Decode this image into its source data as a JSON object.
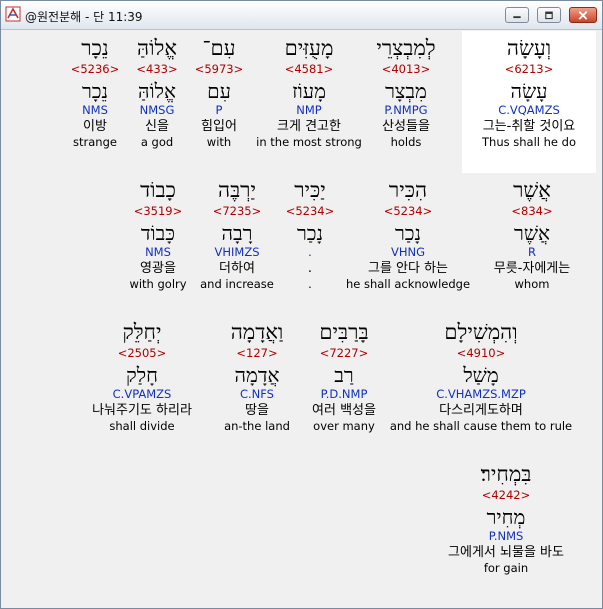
{
  "window": {
    "title": "@원전분해 - 단 11:39"
  },
  "rows": [
    [
      {
        "heb": "וְעָשָׂה",
        "strong": "<6213>",
        "lemma": "עָשָׂה",
        "parse": "C.VQAMZS",
        "kor": "그는-취할 것이요",
        "eng": "Thus shall he do"
      },
      {
        "heb": "לְמִבְצְרֵי",
        "strong": "<4013>",
        "lemma": "מִבְצָר",
        "parse": "P.NMPG",
        "kor": "산성들을",
        "eng": "holds"
      },
      {
        "heb": "מָעֻזִּים",
        "strong": "<4581>",
        "lemma": "מָעוֹז",
        "parse": "NMP",
        "kor": "크게 견고한",
        "eng": "in the most strong"
      },
      {
        "heb": "עִם־",
        "strong": "<5973>",
        "lemma": "עִם",
        "parse": "P",
        "kor": "힘입어",
        "eng": "with"
      },
      {
        "heb": "אֱלוֹהַּ",
        "strong": "<433>",
        "lemma": "אֱלוֹהַּ",
        "parse": "NMSG",
        "kor": "신을",
        "eng": "a god"
      },
      {
        "heb": "נֵכָר",
        "strong": "<5236>",
        "lemma": "נֵכָר",
        "parse": "NMS",
        "kor": "이방",
        "eng": "strange"
      }
    ],
    [
      {
        "heb": "אֲשֶׁר",
        "strong": "<834>",
        "lemma": "אֲשֶׁר",
        "parse": "R",
        "kor": "무릇-자에게는",
        "eng": "whom"
      },
      {
        "heb": "הִכִּיר",
        "strong": "<5234>",
        "lemma": "נָכַר",
        "parse": "VHNG",
        "kor": "그를 안다 하는",
        "eng": "he shall acknowledge"
      },
      {
        "heb": "יַכִּיר",
        "strong": "<5234>",
        "lemma": "נָכַר",
        "parse": ".",
        "kor": ".",
        "eng": "."
      },
      {
        "heb": "יַרְבֶּה",
        "strong": "<7235>",
        "lemma": "רָבָה",
        "parse": "VHIMZS",
        "kor": "더하여",
        "eng": "and increase"
      },
      {
        "heb": "כָבוֹד",
        "strong": "<3519>",
        "lemma": "כָּבוֹד",
        "parse": "NMS",
        "kor": "영광을",
        "eng": "with golry"
      }
    ],
    [
      {
        "heb": "וְהִמְשִׁילָם",
        "strong": "<4910>",
        "lemma": "מָשַׁל",
        "parse": "C.VHAMZS.MZP",
        "kor": "다스리게도하며",
        "eng": "and he shall cause them to rule"
      },
      {
        "heb": "בָּרַבִּים",
        "strong": "<7227>",
        "lemma": "רַב",
        "parse": "P.D.NMP",
        "kor": "여러 백성을",
        "eng": "over many"
      },
      {
        "heb": "וַאֲדָמָה",
        "strong": "<127>",
        "lemma": "אֲדָמָה",
        "parse": "C.NFS",
        "kor": "땅을",
        "eng": "an-the land"
      },
      {
        "heb": "יְחַלֵּק",
        "strong": "<2505>",
        "lemma": "חָלַק",
        "parse": "C.VPAMZS",
        "kor": "나눠주기도 하리라",
        "eng": "shall divide"
      }
    ],
    [
      {
        "heb": "בִּמְחִיר׃",
        "strong": "<4242>",
        "lemma": "מְחִיר",
        "parse": "P.NMS",
        "kor": "그에게서 뇌물을 바도",
        "eng": "for gain"
      }
    ]
  ]
}
